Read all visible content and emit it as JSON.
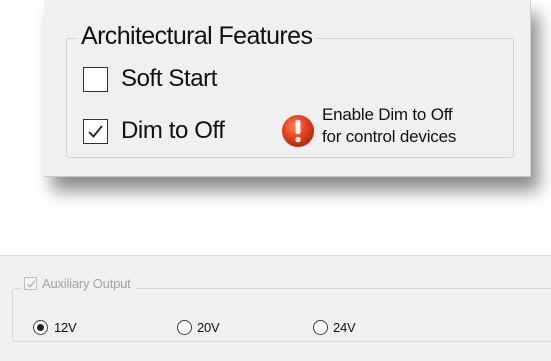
{
  "architectural_features": {
    "title": "Architectural Features",
    "options": [
      {
        "label": "Soft Start",
        "checked": false
      },
      {
        "label": "Dim to Off",
        "checked": true
      }
    ],
    "warning": {
      "icon": "warning-icon",
      "line1": "Enable Dim to Off",
      "line2": "for control devices",
      "color": "#e03b1f"
    }
  },
  "auxiliary_output": {
    "label": "Auxiliary Output",
    "checked": true,
    "enabled": false,
    "voltages": [
      {
        "label": "12V",
        "selected": true
      },
      {
        "label": "20V",
        "selected": false
      },
      {
        "label": "24V",
        "selected": false
      }
    ]
  }
}
